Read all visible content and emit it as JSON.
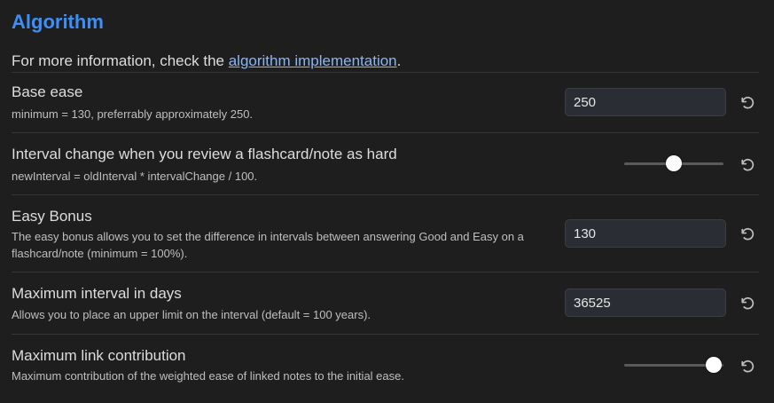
{
  "section": {
    "title": "Algorithm",
    "intro_prefix": "For more information, check the ",
    "intro_link": "algorithm implementation",
    "intro_suffix": "."
  },
  "settings": [
    {
      "name": "Base ease",
      "description": "minimum = 130, preferrably approximately 250.",
      "control": "text",
      "value": "250"
    },
    {
      "name": "Interval change when you review a flashcard/note as hard",
      "description": "newInterval = oldInterval * intervalChange / 100.",
      "control": "slider",
      "slider_fraction": 0.5
    },
    {
      "name": "Easy Bonus",
      "description": "The easy bonus allows you to set the difference in intervals between answering Good and Easy on a flashcard/note (minimum = 100%).",
      "control": "text",
      "value": "130"
    },
    {
      "name": "Maximum interval in days",
      "description": "Allows you to place an upper limit on the interval (default = 100 years).",
      "control": "text",
      "value": "36525"
    },
    {
      "name": "Maximum link contribution",
      "description": "Maximum contribution of the weighted ease of linked notes to the initial ease.",
      "control": "slider",
      "slider_fraction": 0.9
    }
  ],
  "icons": {
    "reset": "reset-icon"
  },
  "colors": {
    "background": "#1e1e1e",
    "title": "#3e8ef7",
    "link": "#8ab4f8",
    "text": "#dcddde",
    "input_bg": "#2a2d33"
  }
}
